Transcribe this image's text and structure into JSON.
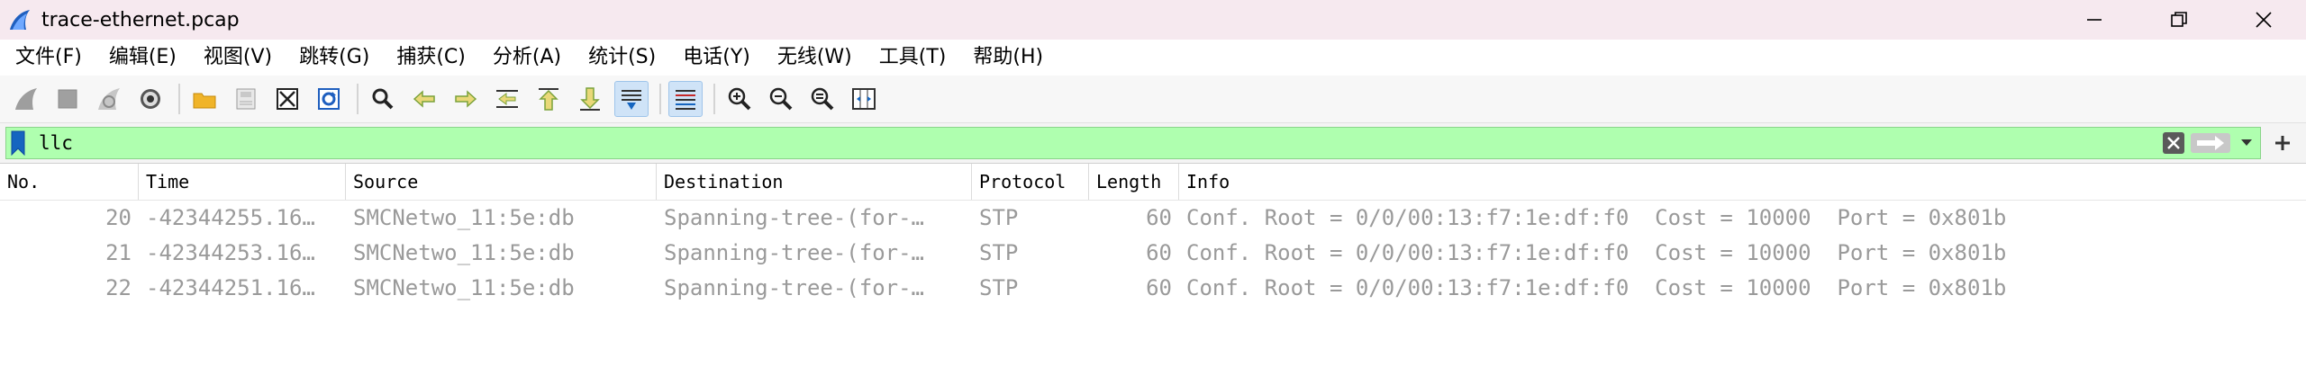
{
  "window": {
    "title": "trace-ethernet.pcap"
  },
  "menu": [
    "文件(F)",
    "编辑(E)",
    "视图(V)",
    "跳转(G)",
    "捕获(C)",
    "分析(A)",
    "统计(S)",
    "电话(Y)",
    "无线(W)",
    "工具(T)",
    "帮助(H)"
  ],
  "toolbar": {
    "icons": [
      "shark-fin-start-icon",
      "stop-square-icon",
      "restart-fin-icon",
      "capture-options-gear-icon",
      "open-folder-icon",
      "save-file-icon",
      "close-file-icon",
      "reload-icon",
      "find-magnifier-icon",
      "back-arrow-icon",
      "forward-arrow-icon",
      "go-to-packet-icon",
      "first-packet-icon",
      "last-packet-icon",
      "autoscroll-icon",
      "colorize-icon",
      "zoom-in-icon",
      "zoom-out-icon",
      "zoom-normal-icon",
      "resize-columns-icon"
    ]
  },
  "filter": {
    "value": "llc"
  },
  "columns": [
    "No.",
    "Time",
    "Source",
    "Destination",
    "Protocol",
    "Length",
    "Info"
  ],
  "packets": [
    {
      "no": "20",
      "time": "-42344255.16…",
      "source": "SMCNetwo_11:5e:db",
      "destination": "Spanning-tree-(for-…",
      "protocol": "STP",
      "length": "60",
      "info": "Conf. Root = 0/0/00:13:f7:1e:df:f0  Cost = 10000  Port = 0x801b"
    },
    {
      "no": "21",
      "time": "-42344253.16…",
      "source": "SMCNetwo_11:5e:db",
      "destination": "Spanning-tree-(for-…",
      "protocol": "STP",
      "length": "60",
      "info": "Conf. Root = 0/0/00:13:f7:1e:df:f0  Cost = 10000  Port = 0x801b"
    },
    {
      "no": "22",
      "time": "-42344251.16…",
      "source": "SMCNetwo_11:5e:db",
      "destination": "Spanning-tree-(for-…",
      "protocol": "STP",
      "length": "60",
      "info": "Conf. Root = 0/0/00:13:f7:1e:df:f0  Cost = 10000  Port = 0x801b"
    }
  ],
  "colors": {
    "titlebar_bg": "#f6e9ef",
    "filter_valid_bg": "#afffaf",
    "row_text": "#9a9a9a",
    "accent_blue": "#1565c0"
  }
}
